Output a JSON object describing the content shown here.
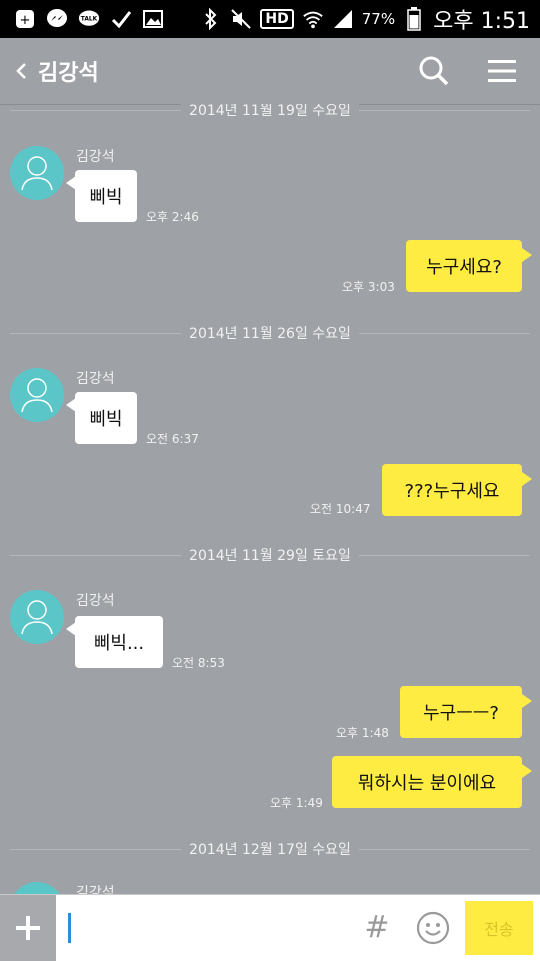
{
  "statusbar": {
    "icons": [
      "kakaotalk-icon",
      "messenger-icon",
      "talk-icon",
      "check-icon",
      "gallery-icon",
      "bluetooth-icon",
      "mute-icon",
      "hd-icon",
      "wifi-icon",
      "signal-icon"
    ],
    "hd_label": "HD",
    "talk_label": "TALK",
    "battery": "77%",
    "time": "오후 1:51"
  },
  "header": {
    "title": "김강석"
  },
  "chat": {
    "dates": [
      "2014년 11월 19일 수요일",
      "2014년 11월 26일 수요일",
      "2014년 11월 29일 토요일",
      "2014년 12월 17일 수요일"
    ],
    "sender": "김강석",
    "messages": [
      {
        "dir": "in",
        "text": "삐빅",
        "time": "오후 2:46"
      },
      {
        "dir": "out",
        "text": "누구세요?",
        "time": "오후 3:03"
      },
      {
        "dir": "in",
        "text": "삐빅",
        "time": "오전 6:37"
      },
      {
        "dir": "out",
        "text": "???누구세요",
        "time": "오전 10:47"
      },
      {
        "dir": "in",
        "text": "삐빅...",
        "time": "오전 8:53"
      },
      {
        "dir": "out",
        "text": "누구ㅡㅡ?",
        "time": "오후 1:48"
      },
      {
        "dir": "out",
        "text": "뭐하시는 분이에요",
        "time": "오후 1:49"
      }
    ]
  },
  "inputbar": {
    "value": "",
    "hash_label": "#",
    "send_label": "전송"
  },
  "colors": {
    "background": "#9ea1a5",
    "outgoing_bubble": "#ffec42",
    "incoming_bubble": "#ffffff",
    "avatar": "#5bc6c7"
  }
}
